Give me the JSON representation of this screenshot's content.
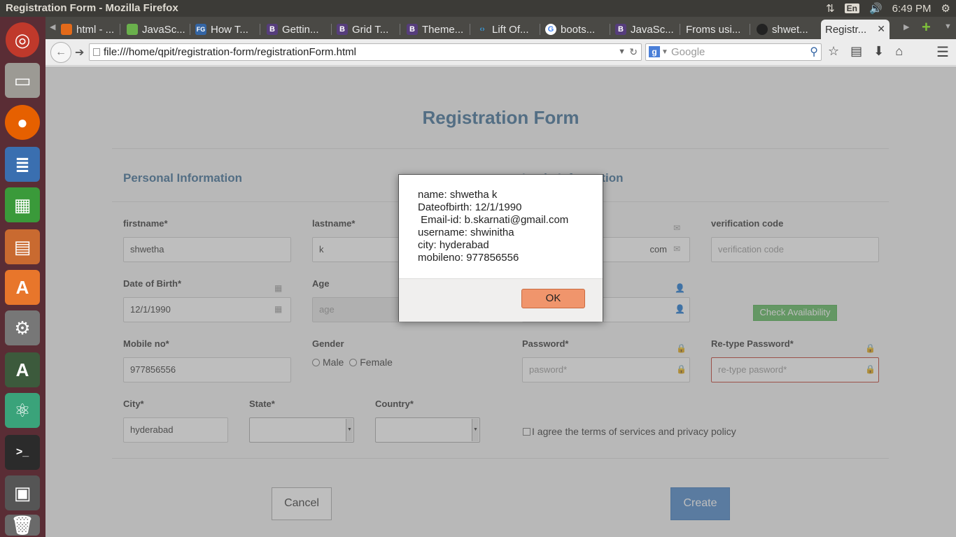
{
  "system": {
    "window_title": "Registration Form - Mozilla Firefox",
    "lang": "En",
    "time": "6:49 PM"
  },
  "tabs": [
    {
      "label": "html - ...",
      "fav": "",
      "fav_color": "#e36a1a"
    },
    {
      "label": "JavaSc...",
      "fav": "",
      "fav_color": "#6ab04c"
    },
    {
      "label": "How T...",
      "fav": "FG",
      "fav_color": "#3465a4"
    },
    {
      "label": "Gettin...",
      "fav": "B",
      "fav_color": "#563d7c"
    },
    {
      "label": "Grid T...",
      "fav": "B",
      "fav_color": "#563d7c"
    },
    {
      "label": "Theme...",
      "fav": "B",
      "fav_color": "#563d7c"
    },
    {
      "label": "Lift Of...",
      "fav": "‹›",
      "fav_color": "#3a9ad9"
    },
    {
      "label": "boots...",
      "fav": "G",
      "fav_color": "#4285f4"
    },
    {
      "label": "JavaSc...",
      "fav": "B",
      "fav_color": "#563d7c"
    },
    {
      "label": "Froms usi...",
      "fav": "",
      "fav_color": "#4a4945"
    },
    {
      "label": "shwet...",
      "fav": "",
      "fav_color": "#222222"
    },
    {
      "label": "Registr...",
      "fav": "",
      "fav_color": "#ececec"
    }
  ],
  "nav": {
    "url": "file:///home/qpit/registration-form/registrationForm.html",
    "search_placeholder": "Google"
  },
  "form": {
    "title": "Registration Form",
    "personal_title": "Personal Information",
    "login_title": "Login Information",
    "firstname_label": "firstname*",
    "firstname_value": "shwetha",
    "lastname_label": "lastname*",
    "lastname_value": "k",
    "email_value_tail": "com",
    "verification_label": "verification code",
    "verification_placeholder": "verification code",
    "dob_label": "Date of Birth*",
    "dob_value": "12/1/1990",
    "age_label": "Age",
    "age_placeholder": "age",
    "check_availability": "Check Availability",
    "mobile_label": "Mobile no*",
    "mobile_value": "977856556",
    "gender_label": "Gender",
    "gender_male": "Male",
    "gender_female": "Female",
    "password_label": "Password*",
    "password_placeholder": "pasword*",
    "retype_label": "Re-type Password*",
    "retype_placeholder": "re-type pasword*",
    "city_label": "City*",
    "city_value": "hyderabad",
    "state_label": "State*",
    "country_label": "Country*",
    "terms": "I agree the terms of services and privacy policy",
    "cancel": "Cancel",
    "create": "Create"
  },
  "dialog": {
    "lines": [
      "name: shwetha k",
      "Dateofbirth: 12/1/1990",
      " Email-id: b.skarnati@gmail.com",
      "username: shwinitha",
      "city: hyderabad",
      "mobileno: 977856556"
    ],
    "ok": "OK"
  }
}
